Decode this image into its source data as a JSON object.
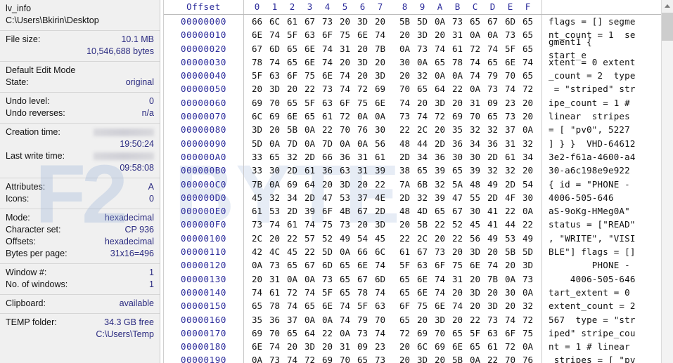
{
  "sidebar": {
    "file_name": "lv_info",
    "file_path": "C:\\Users\\Bkirin\\Desktop",
    "groups": [
      {
        "rows": [
          {
            "label": "File size:",
            "value": "10.1 MB"
          },
          {
            "label": "",
            "value": "10,546,688 bytes"
          }
        ]
      },
      {
        "rows": [
          {
            "label": "Default Edit Mode",
            "value": ""
          },
          {
            "label": "State:",
            "value": "original"
          }
        ]
      },
      {
        "rows": [
          {
            "label": "Undo level:",
            "value": "0"
          },
          {
            "label": "Undo reverses:",
            "value": "n/a"
          }
        ]
      },
      {
        "rows": [
          {
            "label": "Creation time:",
            "value": "",
            "redacted": true
          },
          {
            "label": "",
            "value": "19:50:24"
          },
          {
            "label": "Last write time:",
            "value": "",
            "redacted": true
          },
          {
            "label": "",
            "value": "09:58:08"
          }
        ]
      },
      {
        "rows": [
          {
            "label": "Attributes:",
            "value": "A"
          },
          {
            "label": "Icons:",
            "value": "0"
          }
        ]
      },
      {
        "rows": [
          {
            "label": "Mode:",
            "value": "hexadecimal"
          },
          {
            "label": "Character set:",
            "value": "CP 936"
          },
          {
            "label": "Offsets:",
            "value": "hexadecimal"
          },
          {
            "label": "Bytes per page:",
            "value": "31x16=496"
          }
        ]
      },
      {
        "rows": [
          {
            "label": "Window #:",
            "value": "1"
          },
          {
            "label": "No. of windows:",
            "value": "1"
          }
        ]
      },
      {
        "rows": [
          {
            "label": "Clipboard:",
            "value": "available"
          }
        ]
      },
      {
        "rows": [
          {
            "label": "TEMP folder:",
            "value": "34.3 GB free"
          },
          {
            "label": "",
            "value": "C:\\Users\\Temp"
          }
        ]
      }
    ]
  },
  "hex": {
    "offset_header": "Offset",
    "column_headers": [
      "0",
      "1",
      "2",
      "3",
      "4",
      "5",
      "6",
      "7",
      "8",
      "9",
      "A",
      "B",
      "C",
      "D",
      "E",
      "F"
    ],
    "rows": [
      {
        "offset": "00000000",
        "bytes": [
          "66",
          "6C",
          "61",
          "67",
          "73",
          "20",
          "3D",
          "20",
          "5B",
          "5D",
          "0A",
          "73",
          "65",
          "67",
          "6D",
          "65"
        ],
        "ascii": "flags = [] segme"
      },
      {
        "offset": "00000010",
        "bytes": [
          "6E",
          "74",
          "5F",
          "63",
          "6F",
          "75",
          "6E",
          "74",
          "20",
          "3D",
          "20",
          "31",
          "0A",
          "0A",
          "73",
          "65"
        ],
        "ascii": "nt_count = 1  se"
      },
      {
        "offset": "00000020",
        "bytes": [
          "67",
          "6D",
          "65",
          "6E",
          "74",
          "31",
          "20",
          "7B",
          "0A",
          "73",
          "74",
          "61",
          "72",
          "74",
          "5F",
          "65"
        ],
        "ascii": "gment1 {\nstart_e"
      },
      {
        "offset": "00000030",
        "bytes": [
          "78",
          "74",
          "65",
          "6E",
          "74",
          "20",
          "3D",
          "20",
          "30",
          "0A",
          "65",
          "78",
          "74",
          "65",
          "6E",
          "74"
        ],
        "ascii": "xtent = 0 extent"
      },
      {
        "offset": "00000040",
        "bytes": [
          "5F",
          "63",
          "6F",
          "75",
          "6E",
          "74",
          "20",
          "3D",
          "20",
          "32",
          "0A",
          "0A",
          "74",
          "79",
          "70",
          "65"
        ],
        "ascii": "_count = 2  type"
      },
      {
        "offset": "00000050",
        "bytes": [
          "20",
          "3D",
          "20",
          "22",
          "73",
          "74",
          "72",
          "69",
          "70",
          "65",
          "64",
          "22",
          "0A",
          "73",
          "74",
          "72"
        ],
        "ascii": " = \"striped\" str"
      },
      {
        "offset": "00000060",
        "bytes": [
          "69",
          "70",
          "65",
          "5F",
          "63",
          "6F",
          "75",
          "6E",
          "74",
          "20",
          "3D",
          "20",
          "31",
          "09",
          "23",
          "20"
        ],
        "ascii": "ipe_count = 1 # "
      },
      {
        "offset": "00000070",
        "bytes": [
          "6C",
          "69",
          "6E",
          "65",
          "61",
          "72",
          "0A",
          "0A",
          "73",
          "74",
          "72",
          "69",
          "70",
          "65",
          "73",
          "20"
        ],
        "ascii": "linear  stripes "
      },
      {
        "offset": "00000080",
        "bytes": [
          "3D",
          "20",
          "5B",
          "0A",
          "22",
          "70",
          "76",
          "30",
          "22",
          "2C",
          "20",
          "35",
          "32",
          "32",
          "37",
          "0A"
        ],
        "ascii": "= [ \"pv0\", 5227 "
      },
      {
        "offset": "00000090",
        "bytes": [
          "5D",
          "0A",
          "7D",
          "0A",
          "7D",
          "0A",
          "0A",
          "56",
          "48",
          "44",
          "2D",
          "36",
          "34",
          "36",
          "31",
          "32"
        ],
        "ascii": "] } }  VHD-64612"
      },
      {
        "offset": "000000A0",
        "bytes": [
          "33",
          "65",
          "32",
          "2D",
          "66",
          "36",
          "31",
          "61",
          "2D",
          "34",
          "36",
          "30",
          "30",
          "2D",
          "61",
          "34"
        ],
        "ascii": "3e2-f61a-4600-a4"
      },
      {
        "offset": "000000B0",
        "bytes": [
          "33",
          "30",
          "2D",
          "61",
          "36",
          "63",
          "31",
          "39",
          "38",
          "65",
          "39",
          "65",
          "39",
          "32",
          "32",
          "20"
        ],
        "ascii": "30-a6c198e9e922 "
      },
      {
        "offset": "000000C0",
        "bytes": [
          "7B",
          "0A",
          "69",
          "64",
          "20",
          "3D",
          "20",
          "22",
          "7A",
          "6B",
          "32",
          "5A",
          "48",
          "49",
          "2D",
          "54"
        ],
        "ascii": "{ id = \"PHONE -"
      },
      {
        "offset": "000000D0",
        "bytes": [
          "45",
          "32",
          "34",
          "2D",
          "47",
          "53",
          "37",
          "4E",
          "2D",
          "32",
          "39",
          "47",
          "55",
          "2D",
          "4F",
          "30"
        ],
        "ascii": "4006-505-646"
      },
      {
        "offset": "000000E0",
        "bytes": [
          "61",
          "53",
          "2D",
          "39",
          "6F",
          "4B",
          "67",
          "2D",
          "48",
          "4D",
          "65",
          "67",
          "30",
          "41",
          "22",
          "0A"
        ],
        "ascii": "aS-9oKg-HMeg0A\""
      },
      {
        "offset": "000000F0",
        "bytes": [
          "73",
          "74",
          "61",
          "74",
          "75",
          "73",
          "20",
          "3D",
          "20",
          "5B",
          "22",
          "52",
          "45",
          "41",
          "44",
          "22"
        ],
        "ascii": "status = [\"READ\""
      },
      {
        "offset": "00000100",
        "bytes": [
          "2C",
          "20",
          "22",
          "57",
          "52",
          "49",
          "54",
          "45",
          "22",
          "2C",
          "20",
          "22",
          "56",
          "49",
          "53",
          "49"
        ],
        "ascii": ", \"WRITE\", \"VISI"
      },
      {
        "offset": "00000110",
        "bytes": [
          "42",
          "4C",
          "45",
          "22",
          "5D",
          "0A",
          "66",
          "6C",
          "61",
          "67",
          "73",
          "20",
          "3D",
          "20",
          "5B",
          "5D"
        ],
        "ascii": "BLE\"] flags = []"
      },
      {
        "offset": "00000120",
        "bytes": [
          "0A",
          "73",
          "65",
          "67",
          "6D",
          "65",
          "6E",
          "74",
          "5F",
          "63",
          "6F",
          "75",
          "6E",
          "74",
          "20",
          "3D"
        ],
        "ascii": "        PHONE -"
      },
      {
        "offset": "00000130",
        "bytes": [
          "20",
          "31",
          "0A",
          "0A",
          "73",
          "65",
          "67",
          "6D",
          "65",
          "6E",
          "74",
          "31",
          "20",
          "7B",
          "0A",
          "73"
        ],
        "ascii": "    4006-505-646"
      },
      {
        "offset": "00000140",
        "bytes": [
          "74",
          "61",
          "72",
          "74",
          "5F",
          "65",
          "78",
          "74",
          "65",
          "6E",
          "74",
          "20",
          "3D",
          "20",
          "30",
          "0A"
        ],
        "ascii": "tart_extent = 0 "
      },
      {
        "offset": "00000150",
        "bytes": [
          "65",
          "78",
          "74",
          "65",
          "6E",
          "74",
          "5F",
          "63",
          "6F",
          "75",
          "6E",
          "74",
          "20",
          "3D",
          "20",
          "32"
        ],
        "ascii": "extent_count = 2"
      },
      {
        "offset": "00000160",
        "bytes": [
          "35",
          "36",
          "37",
          "0A",
          "0A",
          "74",
          "79",
          "70",
          "65",
          "20",
          "3D",
          "20",
          "22",
          "73",
          "74",
          "72"
        ],
        "ascii": "567  type = \"str"
      },
      {
        "offset": "00000170",
        "bytes": [
          "69",
          "70",
          "65",
          "64",
          "22",
          "0A",
          "73",
          "74",
          "72",
          "69",
          "70",
          "65",
          "5F",
          "63",
          "6F",
          "75"
        ],
        "ascii": "iped\" stripe_cou"
      },
      {
        "offset": "00000180",
        "bytes": [
          "6E",
          "74",
          "20",
          "3D",
          "20",
          "31",
          "09",
          "23",
          "20",
          "6C",
          "69",
          "6E",
          "65",
          "61",
          "72",
          "0A"
        ],
        "ascii": "nt = 1 # linear"
      },
      {
        "offset": "00000190",
        "bytes": [
          "0A",
          "73",
          "74",
          "72",
          "69",
          "70",
          "65",
          "73",
          "20",
          "3D",
          "20",
          "5B",
          "0A",
          "22",
          "70",
          "76"
        ],
        "ascii": " stripes = [ \"pv"
      }
    ]
  },
  "watermark": {
    "left_text": "F2",
    "right_text": "BYTE",
    "phone_label": "PHONE",
    "phone_number": "4006-505-646"
  },
  "scrollbar": {
    "up_arrow": "scroll-up-arrow"
  },
  "colors": {
    "sidebar_bg": "#f0f0f0",
    "value_text": "#2a2a80",
    "offset_text": "#2a2a9a",
    "byte_text": "#121212"
  }
}
